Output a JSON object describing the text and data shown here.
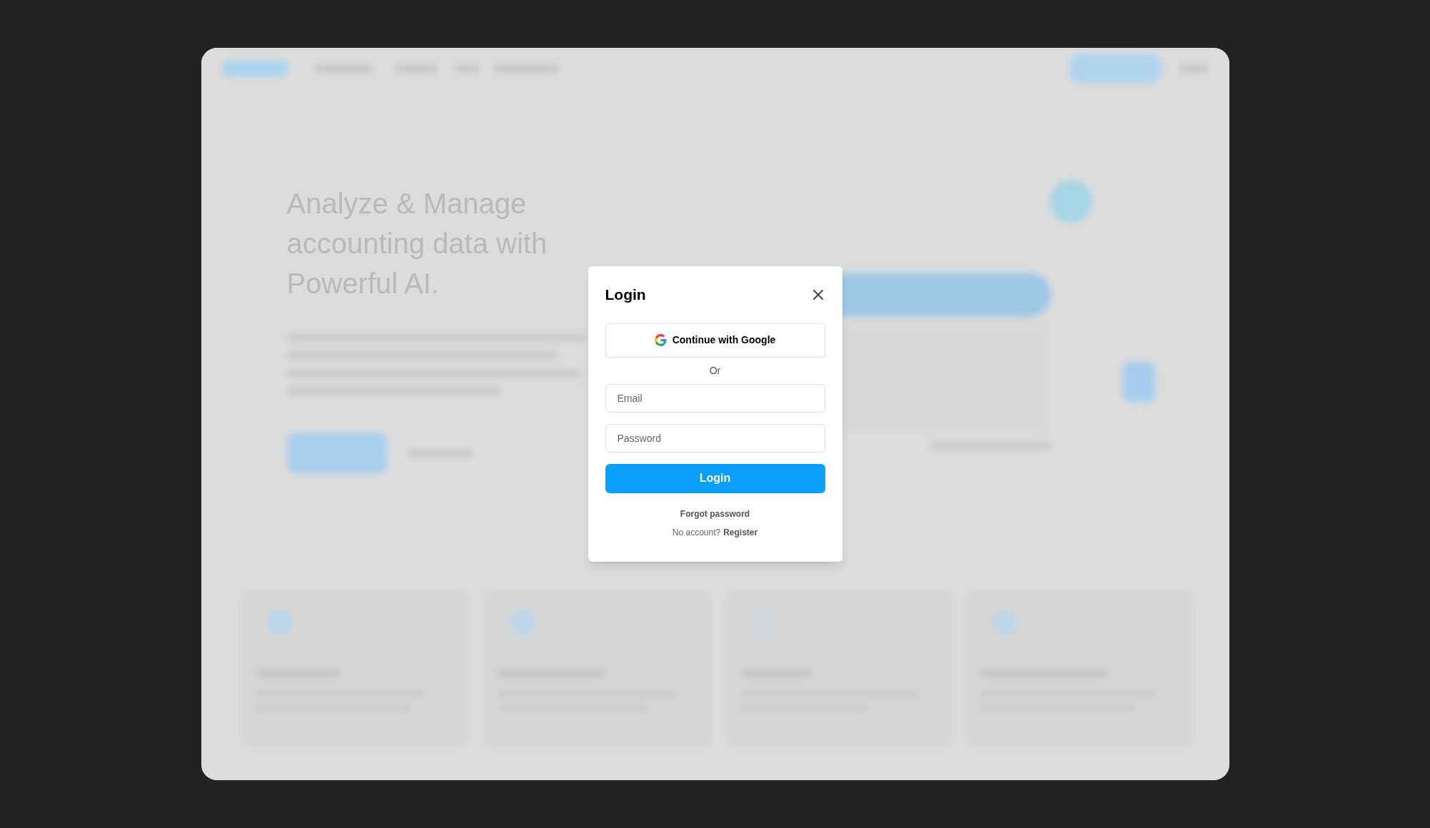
{
  "background": {
    "kind": "picture",
    "heading": "Analyze & Manage accounting data with Powerful AI."
  },
  "dialog": {
    "title": "Login",
    "google_button": "Continue with Google",
    "separator": "Or",
    "fields": [
      {
        "placeholder": "Email"
      },
      {
        "placeholder": "Password"
      }
    ],
    "submit": "Login",
    "forgot_link": "Forgot password",
    "register_prompt": "No account?",
    "register_link": "Register"
  }
}
